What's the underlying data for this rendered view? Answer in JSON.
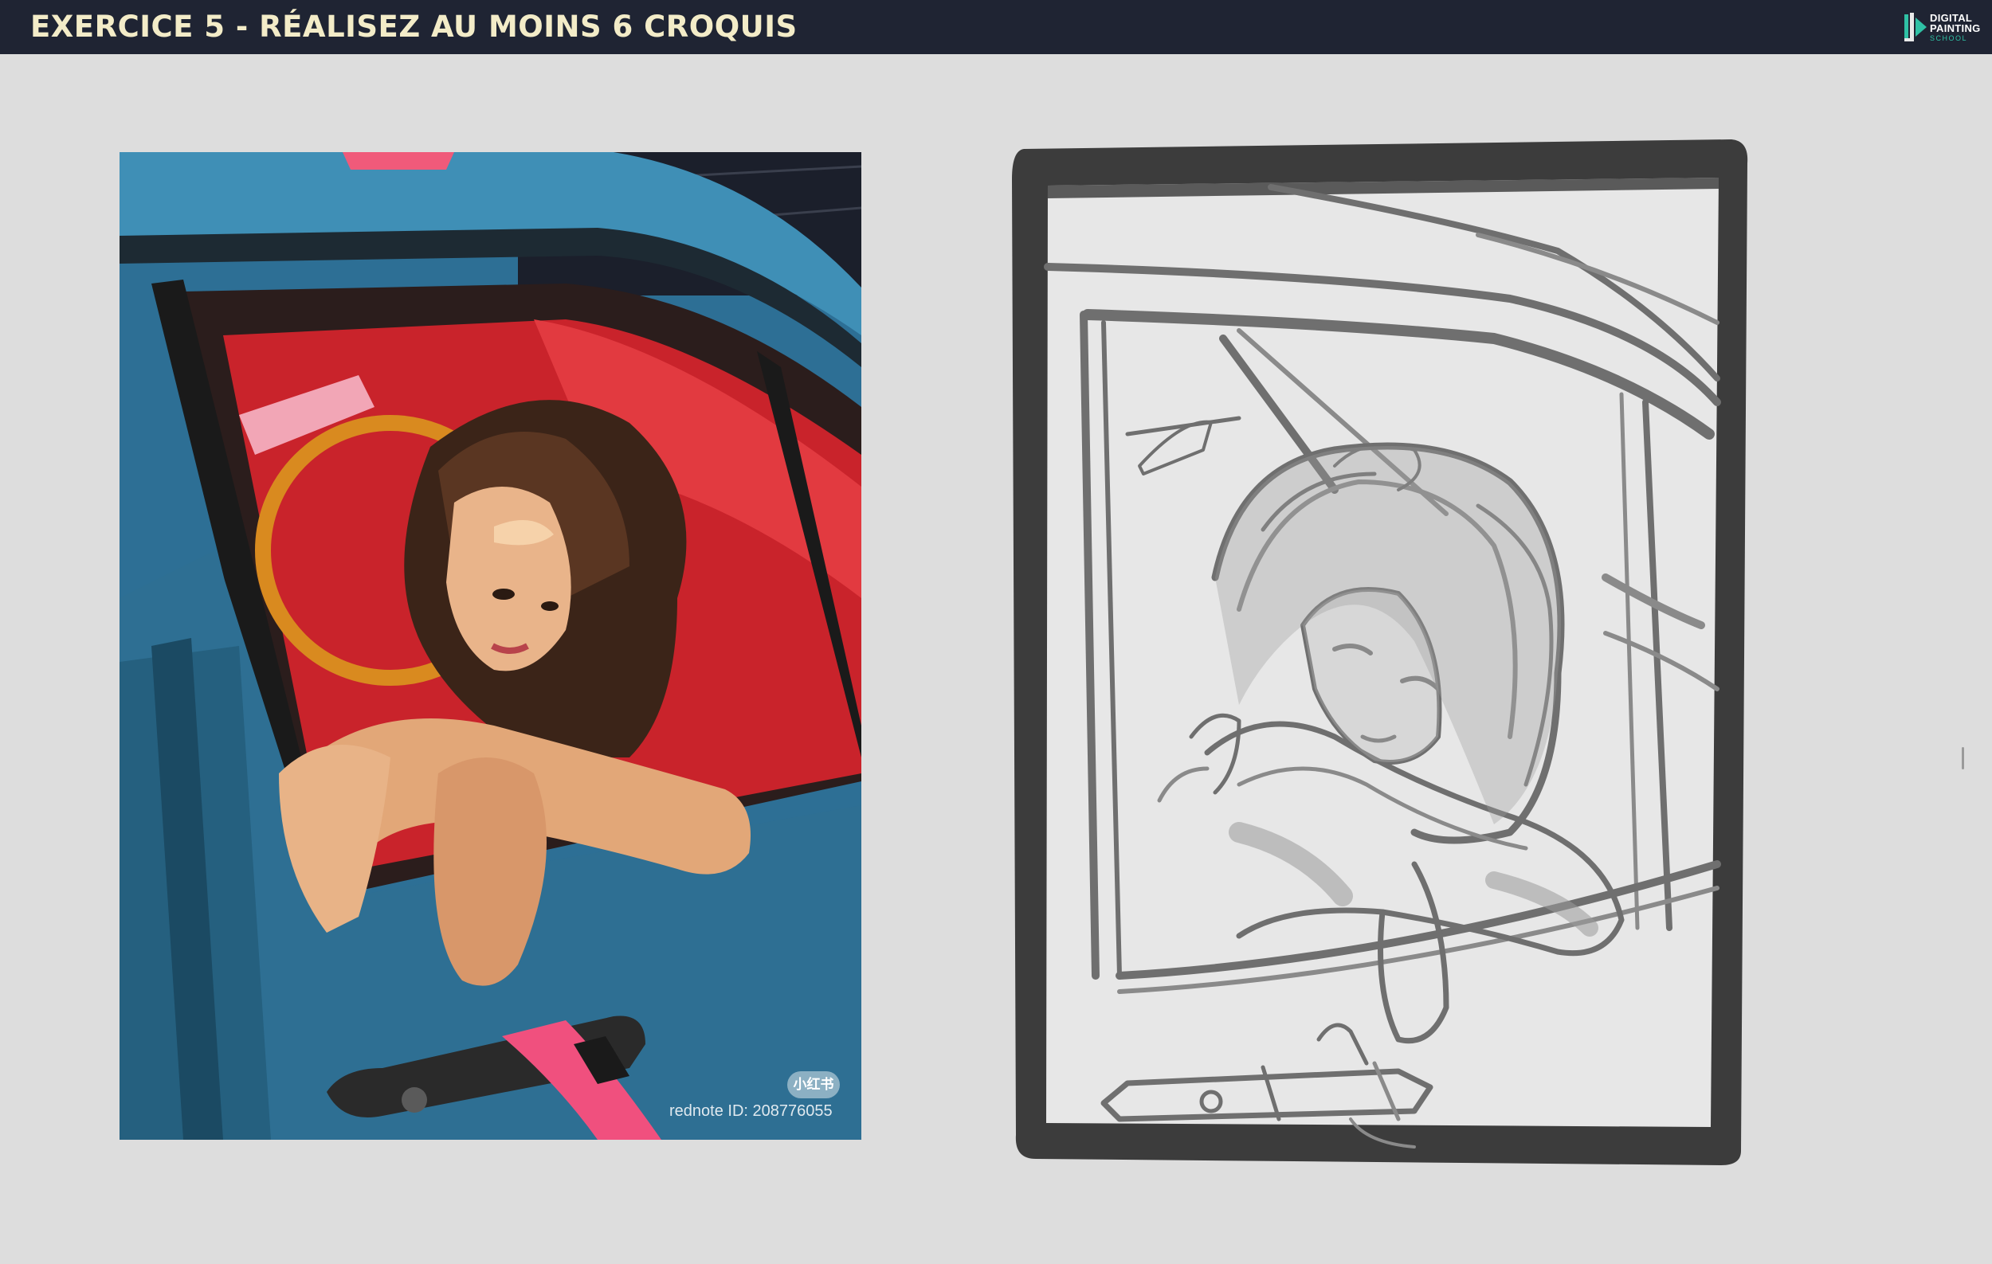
{
  "header": {
    "title": "EXERCICE 5 - RÉALISEZ AU MOINS 6 CROQUIS",
    "logo": {
      "line1": "DIGITAL",
      "line2": "PAINTING",
      "line3": "SCHOOL",
      "icon": "digital-painting-school-logo"
    }
  },
  "reference_photo": {
    "watermark_badge": "小红书",
    "watermark_id": "rednote ID: 208776055",
    "colors": {
      "car_body": "#2d6f95",
      "interior": "#d8262e",
      "tag": "#f0507e"
    }
  },
  "sketch": {
    "icon": "sketch-artwork",
    "colors": {
      "frame": "#3c3c3c",
      "paper": "#e7e7e7",
      "stroke": "#6f6f6f"
    }
  }
}
